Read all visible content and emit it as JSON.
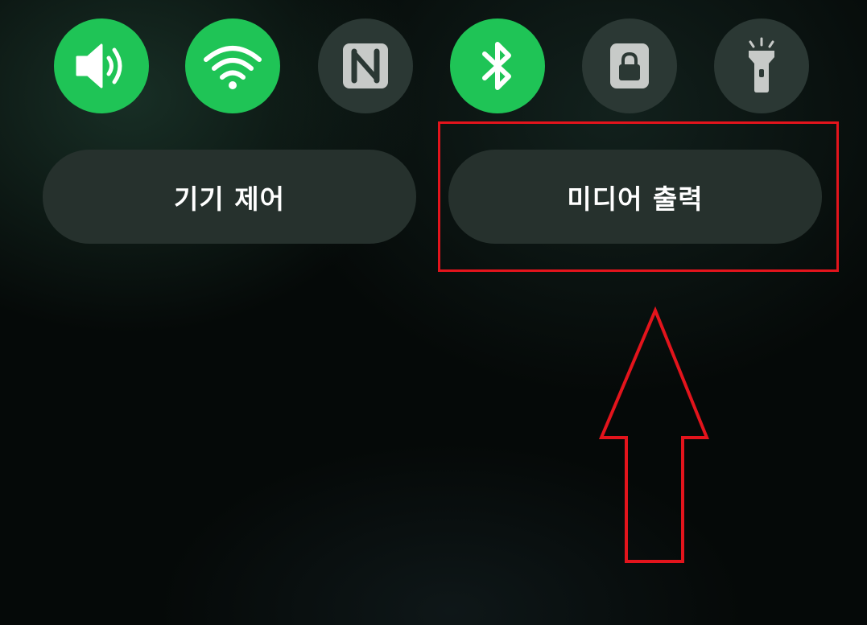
{
  "quick_toggles": [
    {
      "name": "sound",
      "icon": "speaker-icon",
      "state": "on"
    },
    {
      "name": "wifi",
      "icon": "wifi-icon",
      "state": "on"
    },
    {
      "name": "nfc",
      "icon": "nfc-icon",
      "state": "off"
    },
    {
      "name": "bluetooth",
      "icon": "bluetooth-icon",
      "state": "on"
    },
    {
      "name": "screen-lock",
      "icon": "lock-icon",
      "state": "off"
    },
    {
      "name": "flashlight",
      "icon": "flashlight-icon",
      "state": "off"
    }
  ],
  "buttons": {
    "device_control": "기기 제어",
    "media_output": "미디어 출력"
  },
  "annotation": {
    "highlight_color": "#e3141c",
    "highlight_target": "media_output"
  },
  "colors": {
    "toggle_on": "#1fc456",
    "toggle_off": "#2b3834",
    "pill_bg": "#26312d"
  }
}
